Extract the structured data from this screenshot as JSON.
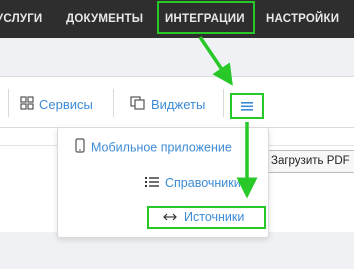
{
  "topnav": {
    "items": [
      {
        "label": "УСЛУГИ"
      },
      {
        "label": "ДОКУМЕНТЫ"
      },
      {
        "label": "ИНТЕГРАЦИИ",
        "active": true
      },
      {
        "label": "НАСТРОЙКИ"
      }
    ]
  },
  "toolbar": {
    "services_label": "Сервисы",
    "widgets_label": "Виджеты",
    "menu_icon": "hamburger-icon"
  },
  "dropdown": {
    "items": [
      {
        "label": "Мобильное приложение",
        "icon": "mobile-phone-icon"
      },
      {
        "label": "Справочники",
        "icon": "list-icon"
      },
      {
        "label": "Источники",
        "icon": "left-right-arrow-icon"
      }
    ]
  },
  "content": {
    "pdf_button_label": "Загрузить PDF"
  },
  "colors": {
    "topbar": "#2e2e2e",
    "link": "#3d8bd6",
    "highlight": "#28c828"
  }
}
